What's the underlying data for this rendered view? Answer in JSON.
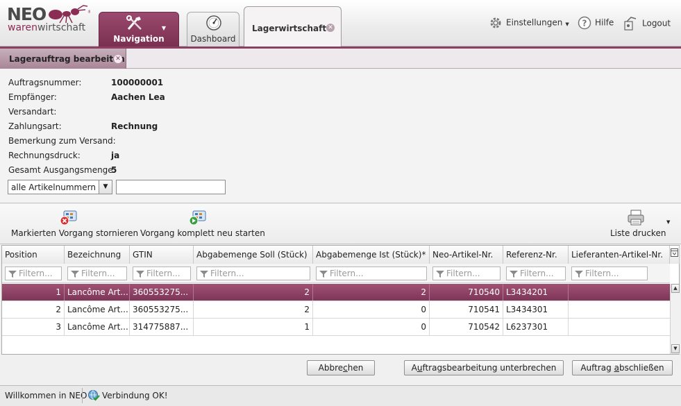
{
  "app": {
    "logo_text_neo": "NEO",
    "logo_text_waren": "waren",
    "logo_text_wirtschaft": "wirtschaft",
    "brand_color": "#8b2c54"
  },
  "main_tabs": {
    "navigation": "Navigation",
    "dashboard": "Dashboard",
    "lagerwirtschaft": "Lagerwirtschaft"
  },
  "top_links": {
    "settings": "Einstellungen",
    "help": "Hilfe",
    "logout": "Logout"
  },
  "subtab": {
    "label": "Lagerauftrag bearbeiten"
  },
  "info": {
    "order_number_label": "Auftragsnummer:",
    "order_number": "100000001",
    "recipient_label": "Empfänger:",
    "recipient": "Aachen Lea",
    "shipping_label": "Versandart:",
    "shipping": "",
    "payment_label": "Zahlungsart:",
    "payment": "Rechnung",
    "remark_label": "Bemerkung zum Versand:",
    "remark": "",
    "invoice_print_label": "Rechnungsdruck:",
    "invoice_print": "ja",
    "total_label": "Gesamt Ausgangsmenge:",
    "total": "5"
  },
  "article_filter": {
    "selected": "alle Artikelnummern",
    "input_value": ""
  },
  "toolbar": {
    "cancel_label": "Markierten Vorgang stornieren",
    "restart_label": "Vorgang komplett neu starten",
    "print_label": "Liste drucken"
  },
  "grid": {
    "columns": [
      "Position",
      "Bezeichnung",
      "GTIN",
      "Abgabemenge Soll (Stück)",
      "Abgabemenge Ist (Stück)*",
      "Neo-Artikel-Nr.",
      "Referenz-Nr.",
      "Lieferanten-Artikel-Nr."
    ],
    "filter_placeholder": "Filtern...",
    "rows": [
      {
        "position": "1",
        "bezeichnung": "Lancôme Art...",
        "gtin": "360553275...",
        "soll": "2",
        "ist": "2",
        "neo": "710540",
        "ref": "L3434201",
        "lief": ""
      },
      {
        "position": "2",
        "bezeichnung": "Lancôme Art...",
        "gtin": "360553275...",
        "soll": "2",
        "ist": "0",
        "neo": "710541",
        "ref": "L3434301",
        "lief": ""
      },
      {
        "position": "3",
        "bezeichnung": "Lancôme Art...",
        "gtin": "314775887...",
        "soll": "1",
        "ist": "0",
        "neo": "710542",
        "ref": "L6237301",
        "lief": ""
      }
    ]
  },
  "footer_buttons": {
    "abbrechen_pre": "Abbre",
    "abbrechen_u": "c",
    "abbrechen_post": "hen",
    "interrupt_pre": "A",
    "interrupt_u": "u",
    "interrupt_post": "ftragsbearbeitung unterbrechen",
    "finish_pre": "Auftrag ",
    "finish_u": "a",
    "finish_post": "bschließen"
  },
  "status": {
    "welcome": "Willkommen in NEO",
    "connection": "Verbindung OK!"
  }
}
